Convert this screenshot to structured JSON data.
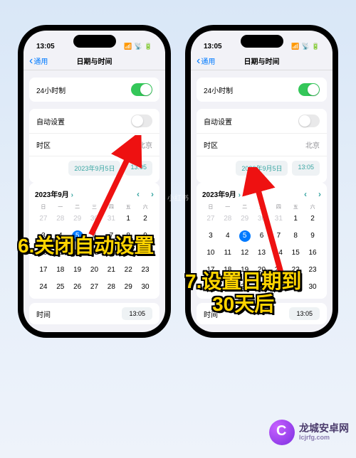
{
  "status": {
    "time": "13:05"
  },
  "nav": {
    "back": "通用",
    "title": "日期与时间"
  },
  "rows": {
    "format24": "24小时制",
    "autoSet": "自动设置",
    "timezone": "时区",
    "timezoneValue": "北京",
    "timeLabel": "时间"
  },
  "preview": {
    "date": "2023年9月5日",
    "time": "13:05"
  },
  "calendar": {
    "month": "2023年9月",
    "weekdays": [
      "日",
      "一",
      "二",
      "三",
      "四",
      "五",
      "六"
    ],
    "leading": [
      27,
      28,
      29,
      30,
      31
    ],
    "days": [
      1,
      2,
      3,
      4,
      5,
      6,
      7,
      8,
      9,
      10,
      11,
      12,
      13,
      14,
      15,
      16,
      17,
      18,
      19,
      20,
      21,
      22,
      23,
      24,
      25,
      26,
      27,
      28,
      29,
      30
    ],
    "selected": 5
  },
  "timeValue": "13:05",
  "captions": {
    "c6": "6.关闭自动设置",
    "c7": "7.设置日期到\n30天后"
  },
  "brand": {
    "name": "龙城安卓网",
    "url": "lcjrfg.com"
  },
  "watermark": "小红书"
}
